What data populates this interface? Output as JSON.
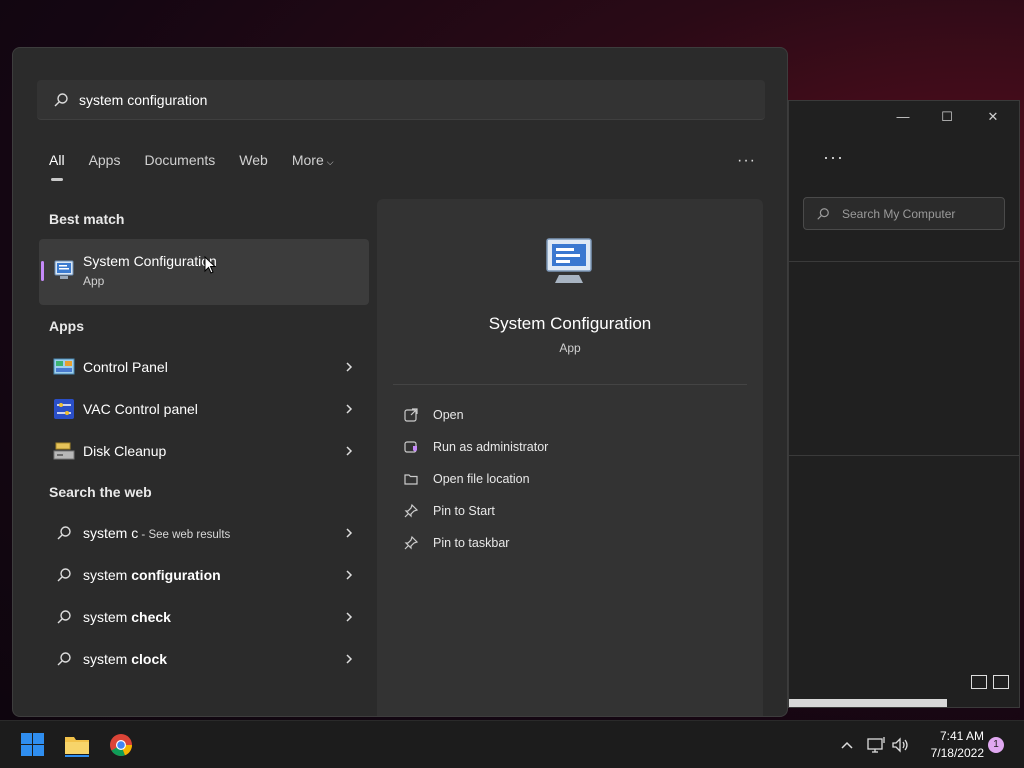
{
  "explorer": {
    "search_placeholder": "Search My Computer",
    "more_label": "···",
    "minimize": "—",
    "maximize": "☐",
    "close": "✕"
  },
  "start": {
    "search_value": "system configuration",
    "tabs": [
      {
        "label": "All",
        "active": true
      },
      {
        "label": "Apps"
      },
      {
        "label": "Documents"
      },
      {
        "label": "Web"
      },
      {
        "label": "More"
      }
    ],
    "more_options": "···",
    "best_match_heading": "Best match",
    "best_match": {
      "title": "System Configuration",
      "subtitle": "App"
    },
    "apps_heading": "Apps",
    "apps": [
      {
        "label": "Control Panel",
        "icon": "control-panel-icon"
      },
      {
        "label": "VAC Control panel",
        "icon": "vac-control-icon"
      },
      {
        "label": "Disk Cleanup",
        "icon": "disk-cleanup-icon"
      }
    ],
    "web_heading": "Search the web",
    "web_results": [
      {
        "label": "system c",
        "sub": " - See web results"
      },
      {
        "label_prefix": "system ",
        "label_bold": "configuration"
      },
      {
        "label_prefix": "system ",
        "label_bold": "check"
      },
      {
        "label_prefix": "system ",
        "label_bold": "clock"
      }
    ],
    "preview": {
      "name": "System Configuration",
      "kind": "App",
      "actions": [
        {
          "label": "Open",
          "icon": "open-external-icon"
        },
        {
          "label": "Run as administrator",
          "icon": "shield-admin-icon"
        },
        {
          "label": "Open file location",
          "icon": "folder-icon"
        },
        {
          "label": "Pin to Start",
          "icon": "pin-icon"
        },
        {
          "label": "Pin to taskbar",
          "icon": "pin-icon"
        }
      ]
    }
  },
  "taskbar": {
    "time": "7:41 AM",
    "date": "7/18/2022",
    "notification_count": "1"
  },
  "colors": {
    "accent": "#c58af9",
    "panel": "#2b2b2b",
    "taskbar": "#1c1c1c"
  }
}
